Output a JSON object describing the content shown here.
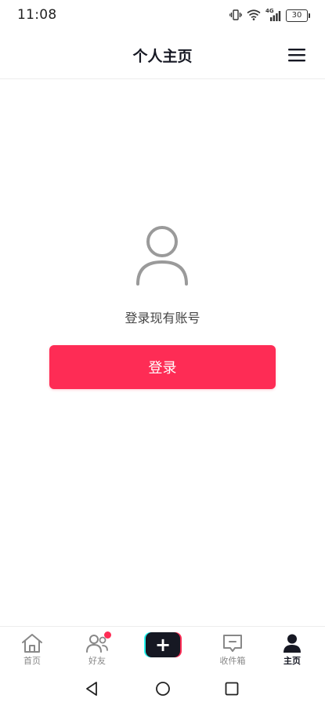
{
  "status_bar": {
    "time": "11:08",
    "network": "4G",
    "battery": "30"
  },
  "header": {
    "title": "个人主页",
    "menu_icon": "hamburger-menu-icon"
  },
  "main": {
    "avatar_icon": "user-placeholder-icon",
    "login_prompt": "登录现有账号",
    "login_button_label": "登录"
  },
  "tab_bar": {
    "tabs": [
      {
        "label": "首页",
        "icon": "home-icon"
      },
      {
        "label": "好友",
        "icon": "friends-icon",
        "badge": true
      },
      {
        "label": "",
        "icon": "plus-icon"
      },
      {
        "label": "收件箱",
        "icon": "inbox-icon"
      },
      {
        "label": "主页",
        "icon": "profile-icon",
        "active": true
      }
    ]
  },
  "system_nav": {
    "back_icon": "back-triangle-icon",
    "home_icon": "home-circle-icon",
    "recents_icon": "recents-square-icon"
  },
  "colors": {
    "accent": "#fe2c55",
    "cyan": "#25f4ee",
    "dark": "#161823",
    "muted": "#888888"
  }
}
